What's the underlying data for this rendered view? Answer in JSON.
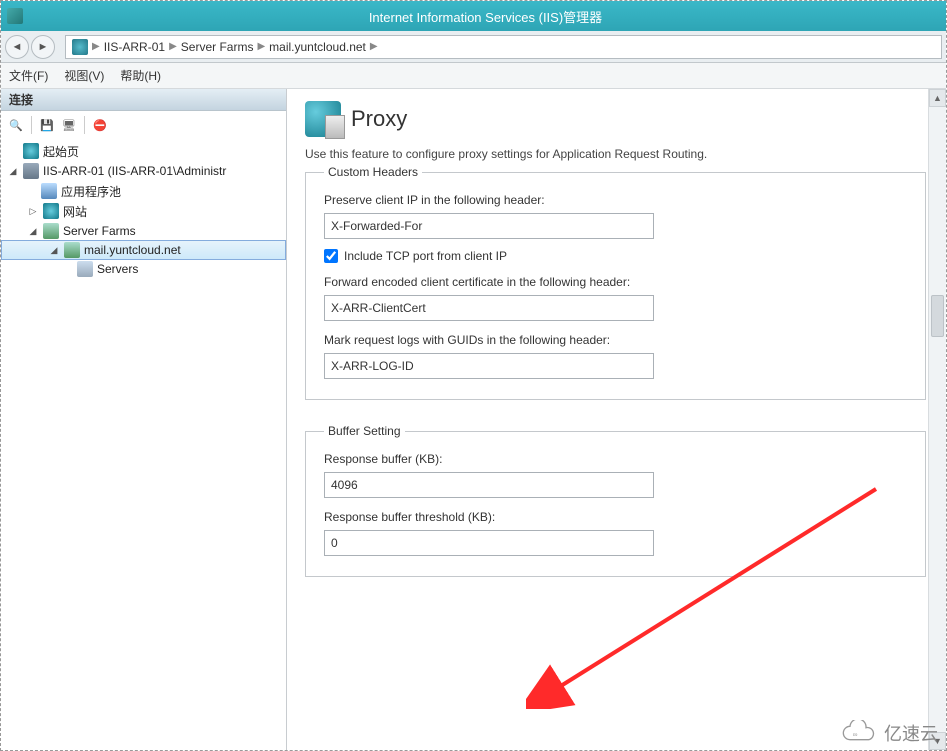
{
  "window": {
    "title": "Internet Information Services (IIS)管理器"
  },
  "breadcrumbs": {
    "root": "IIS-ARR-01",
    "a": "Server Farms",
    "b": "mail.yuntcloud.net"
  },
  "menu": {
    "file": "文件(F)",
    "view": "视图(V)",
    "help": "帮助(H)"
  },
  "sidebar": {
    "header": "连接",
    "start": "起始页",
    "host": "IIS-ARR-01 (IIS-ARR-01\\Administr",
    "pool": "应用程序池",
    "sites": "网站",
    "farms": "Server Farms",
    "farm1": "mail.yuntcloud.net",
    "servers": "Servers"
  },
  "page": {
    "title": "Proxy",
    "description": "Use this feature to configure proxy settings for Application Request Routing."
  },
  "custom": {
    "legend": "Custom Headers",
    "preserve_label": "Preserve client IP in the following header:",
    "preserve_value": "X-Forwarded-For",
    "include_tcp": "Include TCP port from client IP",
    "cert_label": "Forward encoded client certificate in the following header:",
    "cert_value": "X-ARR-ClientCert",
    "log_label": "Mark request logs with GUIDs in the following header:",
    "log_value": "X-ARR-LOG-ID"
  },
  "buffer": {
    "legend": "Buffer Setting",
    "resp_label": "Response buffer (KB):",
    "resp_value": "4096",
    "thresh_label": "Response buffer threshold (KB):",
    "thresh_value": "0"
  },
  "watermark": "亿速云"
}
